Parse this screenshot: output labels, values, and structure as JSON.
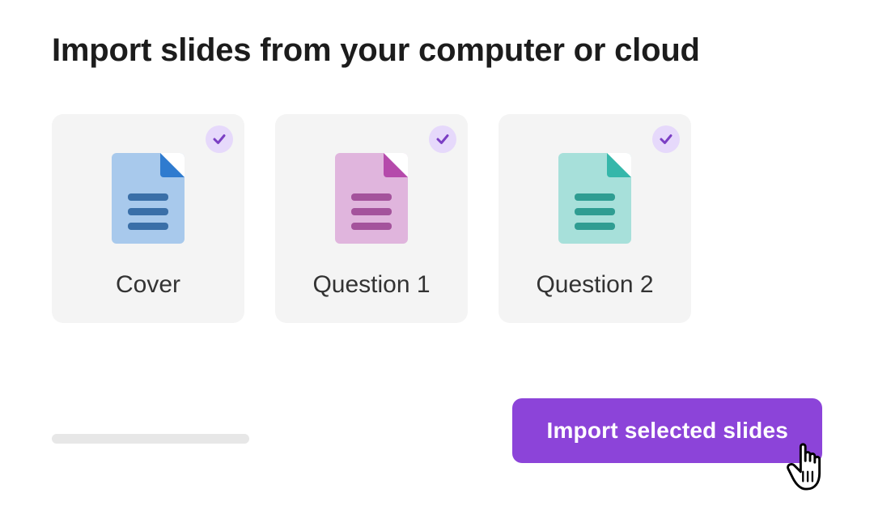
{
  "title": "Import slides from your computer or cloud",
  "slides": [
    {
      "label": "Cover",
      "color": "blue",
      "selected": true
    },
    {
      "label": "Question 1",
      "color": "pink",
      "selected": true
    },
    {
      "label": "Question 2",
      "color": "teal",
      "selected": true
    }
  ],
  "colors": {
    "accent": "#8c44d9",
    "badge_bg": "#e6d9fb",
    "check_mark": "#7b3fc4",
    "card_bg": "#f4f4f4",
    "progress_bg": "#e7e7e7"
  },
  "actions": {
    "import_label": "Import selected slides"
  }
}
